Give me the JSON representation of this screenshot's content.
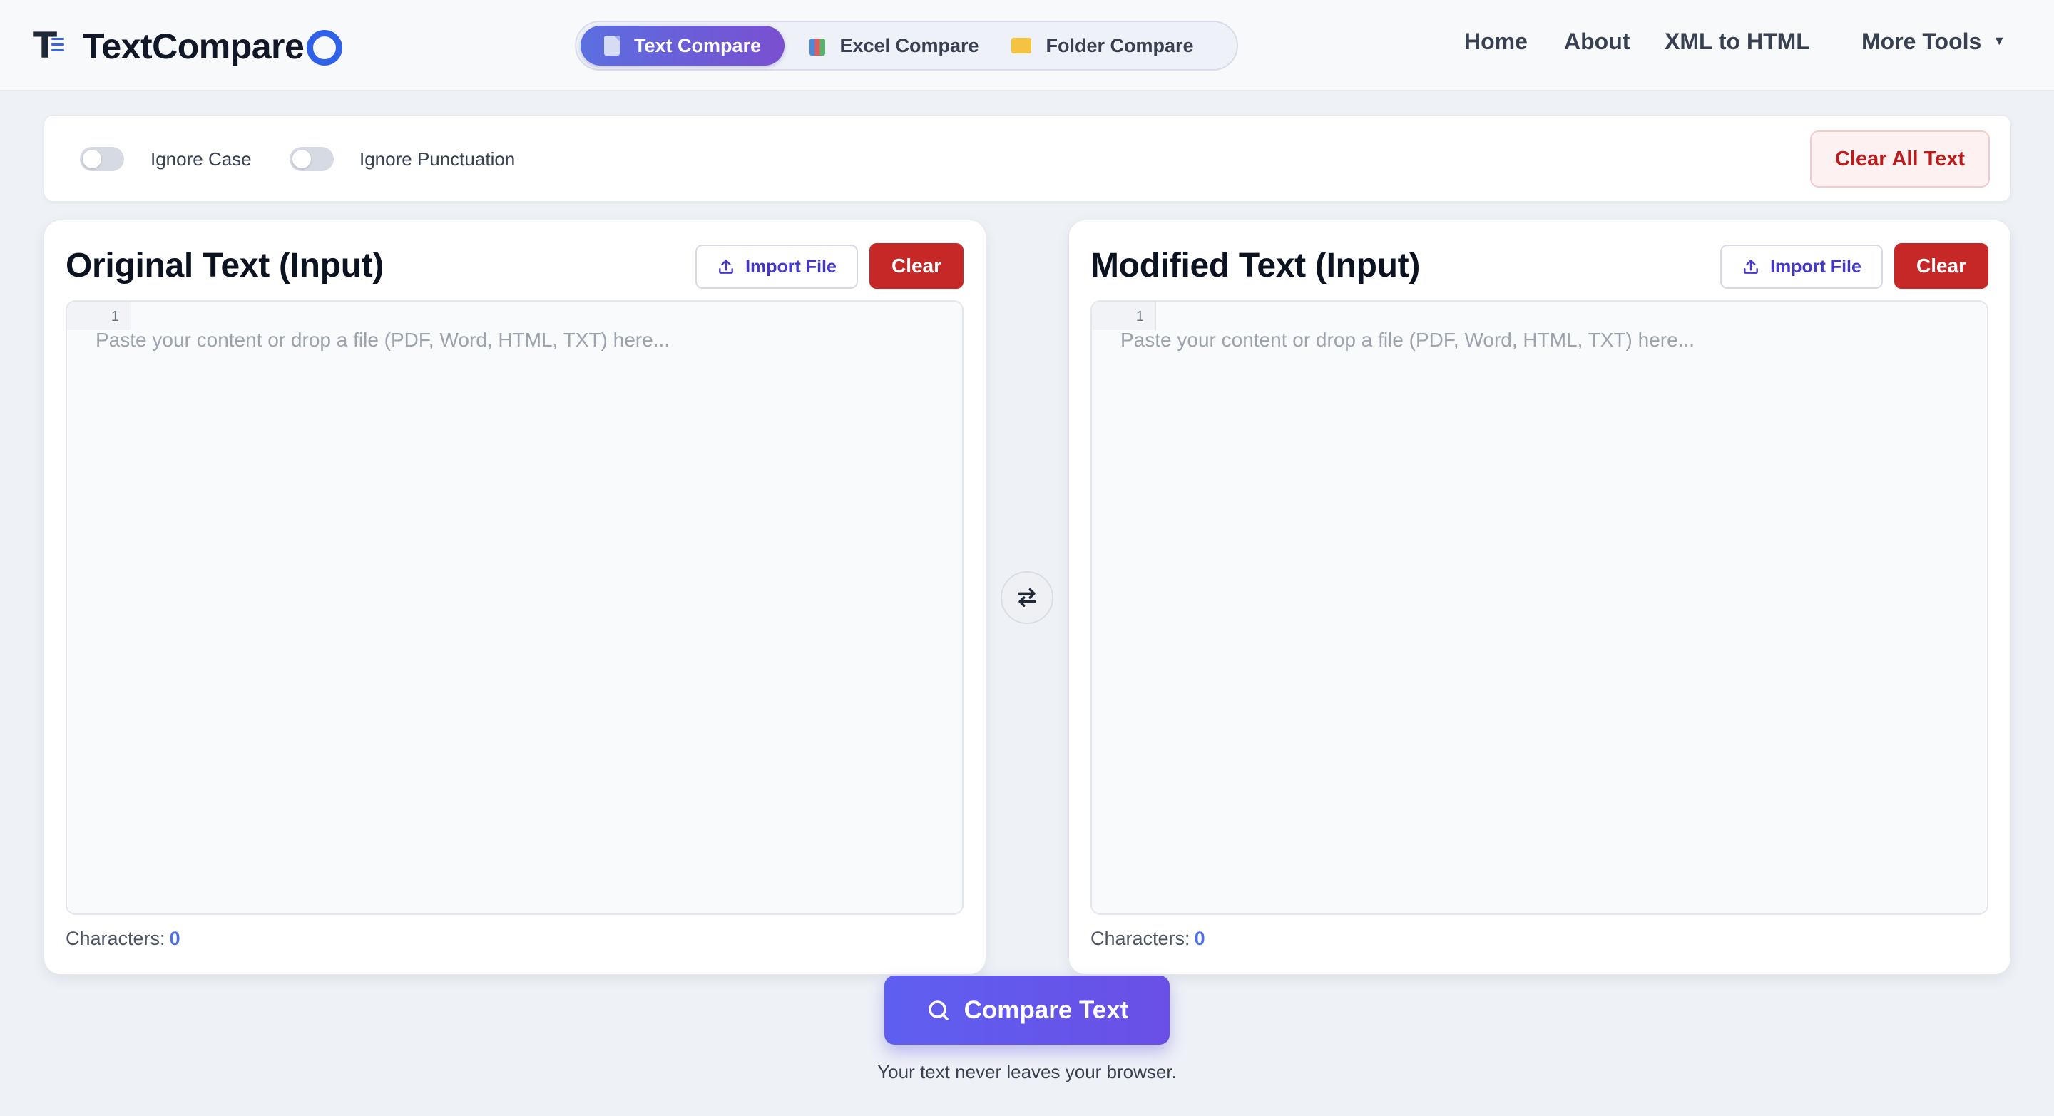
{
  "brand": {
    "name": "TextCompare",
    "icon": "textcompare-logo-icon",
    "accent": "#2f62e8"
  },
  "mode_tabs": [
    {
      "label": "Text Compare",
      "icon": "document-icon",
      "active": true
    },
    {
      "label": "Excel Compare",
      "icon": "spreadsheet-icon",
      "active": false
    },
    {
      "label": "Folder Compare",
      "icon": "folder-icon",
      "active": false
    }
  ],
  "nav": {
    "home": "Home",
    "about": "About",
    "xml_to_html": "XML to HTML",
    "more_tools": "More Tools",
    "more_caret": "▼"
  },
  "options": {
    "ignore_case": {
      "label": "Ignore Case",
      "on": false
    },
    "ignore_punctuation": {
      "label": "Ignore Punctuation",
      "on": false
    },
    "clear_all": "Clear All Text"
  },
  "panels": {
    "original": {
      "title": "Original Text (Input)",
      "import_label": "Import File",
      "clear_label": "Clear",
      "line_number": "1",
      "placeholder": "Paste your content or drop a file (PDF, Word, HTML, TXT) here...",
      "chars_label": "Characters:",
      "chars_count": "0"
    },
    "modified": {
      "title": "Modified Text (Input)",
      "import_label": "Import File",
      "clear_label": "Clear",
      "line_number": "1",
      "placeholder": "Paste your content or drop a file (PDF, Word, HTML, TXT) here...",
      "chars_label": "Characters:",
      "chars_count": "0"
    }
  },
  "swap_icon": "swap-arrows-icon",
  "compare": {
    "label": "Compare Text",
    "icon": "search-icon"
  },
  "privacy_note": "Your text never leaves your browser.",
  "colors": {
    "primary_gradient_start": "#5b6fe0",
    "primary_gradient_end": "#7a4fd0",
    "danger": "#c62828",
    "link": "#4338ca"
  }
}
